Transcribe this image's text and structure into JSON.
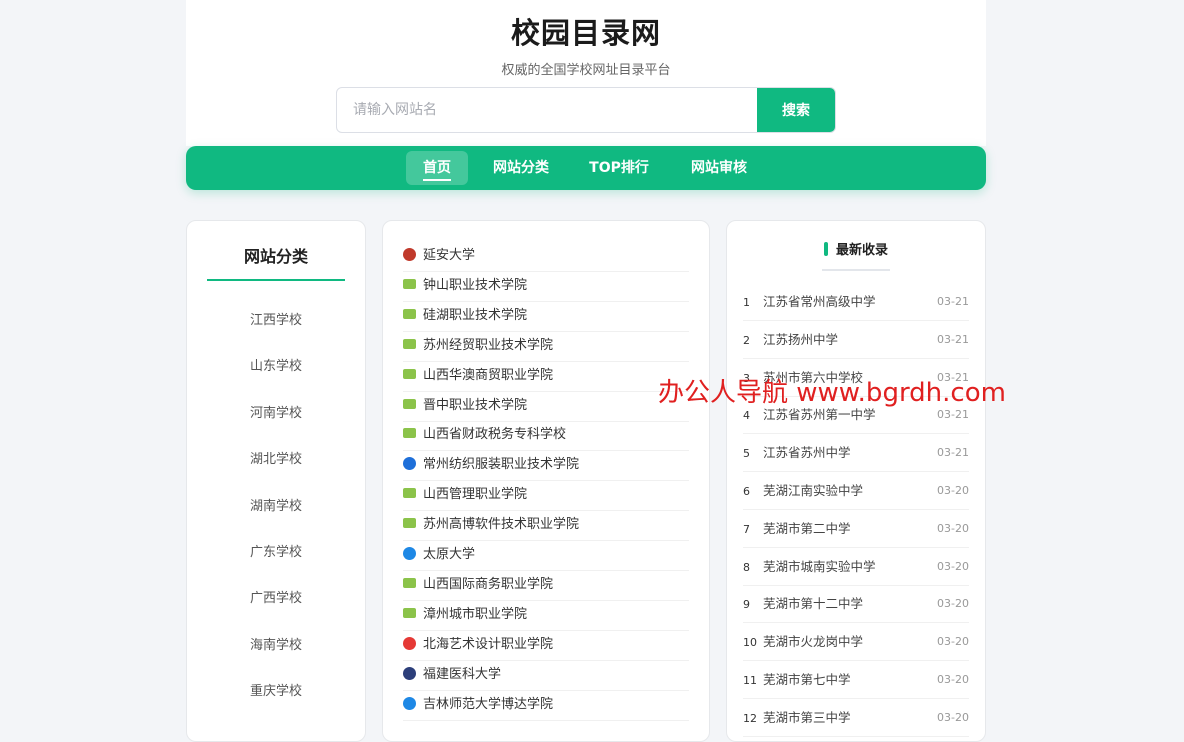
{
  "header": {
    "title": "校园目录网",
    "subtitle": "权威的全国学校网址目录平台",
    "search_placeholder": "请输入网站名",
    "search_button": "搜索"
  },
  "nav": [
    "首页",
    "网站分类",
    "TOP排行",
    "网站审核"
  ],
  "categories": {
    "title": "网站分类",
    "items": [
      "江西学校",
      "山东学校",
      "河南学校",
      "湖北学校",
      "湖南学校",
      "广东学校",
      "广西学校",
      "海南学校",
      "重庆学校"
    ]
  },
  "schools": [
    {
      "name": "延安大学",
      "icon": "seal-icon",
      "color": "#c0392b"
    },
    {
      "name": "钟山职业技术学院",
      "icon": "school-logo-icon",
      "color": "#8bc34a"
    },
    {
      "name": "硅湖职业技术学院",
      "icon": "school-logo-icon",
      "color": "#8bc34a"
    },
    {
      "name": "苏州经贸职业技术学院",
      "icon": "school-logo-icon",
      "color": "#8bc34a"
    },
    {
      "name": "山西华澳商贸职业学院",
      "icon": "school-logo-icon",
      "color": "#8bc34a"
    },
    {
      "name": "晋中职业技术学院",
      "icon": "school-logo-icon",
      "color": "#8bc34a"
    },
    {
      "name": "山西省财政税务专科学校",
      "icon": "school-logo-icon",
      "color": "#8bc34a"
    },
    {
      "name": "常州纺织服装职业技术学院",
      "icon": "swoosh-icon",
      "color": "#1e6fd9"
    },
    {
      "name": "山西管理职业学院",
      "icon": "school-logo-icon",
      "color": "#8bc34a"
    },
    {
      "name": "苏州高博软件技术职业学院",
      "icon": "school-logo-icon",
      "color": "#8bc34a"
    },
    {
      "name": "太原大学",
      "icon": "badge-icon",
      "color": "#1e88e5"
    },
    {
      "name": "山西国际商务职业学院",
      "icon": "school-logo-icon",
      "color": "#8bc34a"
    },
    {
      "name": "漳州城市职业学院",
      "icon": "school-logo-icon",
      "color": "#8bc34a"
    },
    {
      "name": "北海艺术设计职业学院",
      "icon": "swirl-icon",
      "color": "#e53935"
    },
    {
      "name": "福建医科大学",
      "icon": "seal-icon",
      "color": "#2c3e7a"
    },
    {
      "name": "吉林师范大学博达学院",
      "icon": "seal-icon",
      "color": "#1e88e5"
    }
  ],
  "latest": {
    "title": "最新收录",
    "items": [
      {
        "num": "1",
        "name": "江苏省常州高级中学",
        "date": "03-21"
      },
      {
        "num": "2",
        "name": "江苏扬州中学",
        "date": "03-21"
      },
      {
        "num": "3",
        "name": "苏州市第六中学校",
        "date": "03-21"
      },
      {
        "num": "4",
        "name": "江苏省苏州第一中学",
        "date": "03-21"
      },
      {
        "num": "5",
        "name": "江苏省苏州中学",
        "date": "03-21"
      },
      {
        "num": "6",
        "name": "芜湖江南实验中学",
        "date": "03-20"
      },
      {
        "num": "7",
        "name": "芜湖市第二中学",
        "date": "03-20"
      },
      {
        "num": "8",
        "name": "芜湖市城南实验中学",
        "date": "03-20"
      },
      {
        "num": "9",
        "name": "芜湖市第十二中学",
        "date": "03-20"
      },
      {
        "num": "10",
        "name": "芜湖市火龙岗中学",
        "date": "03-20"
      },
      {
        "num": "11",
        "name": "芜湖市第七中学",
        "date": "03-20"
      },
      {
        "num": "12",
        "name": "芜湖市第三中学",
        "date": "03-20"
      }
    ]
  },
  "watermark": "办公人导航 www.bgrdh.com"
}
